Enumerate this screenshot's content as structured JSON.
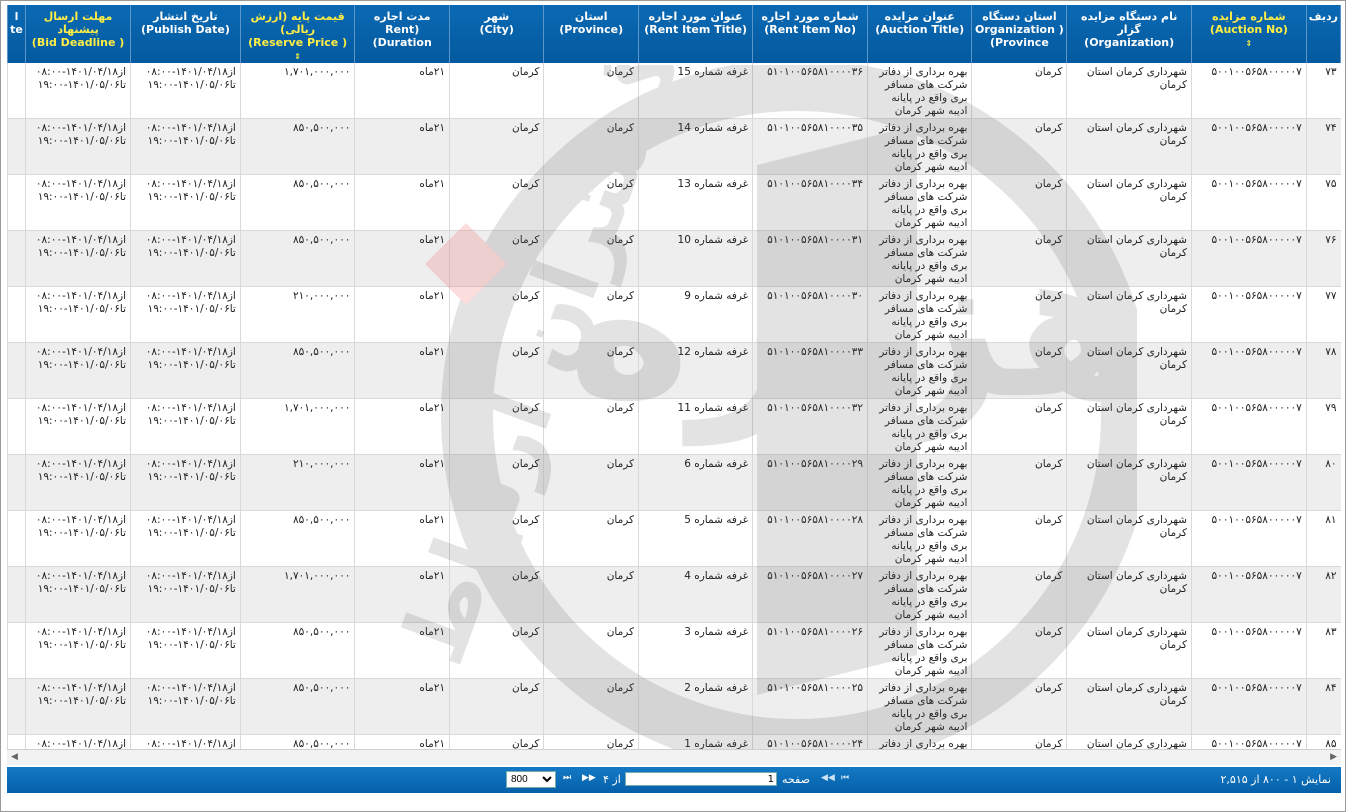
{
  "columns": [
    {
      "fa": "ردیف",
      "en": "",
      "highlight": false
    },
    {
      "fa": "شماره مزایده",
      "en": "(Auction No)",
      "highlight": true,
      "sort": true
    },
    {
      "fa": "نام دستگاه مزایده گزار",
      "en": "(Organization)",
      "highlight": false
    },
    {
      "fa": "استان دستگاه",
      "en": "Organization ) (Province",
      "highlight": false
    },
    {
      "fa": "عنوان مزایده",
      "en": "(Auction Title)",
      "highlight": false
    },
    {
      "fa": "شماره مورد اجاره",
      "en": "(Rent Item No)",
      "highlight": false
    },
    {
      "fa": "عنوان مورد اجاره",
      "en": "(Rent Item Title)",
      "highlight": false
    },
    {
      "fa": "استان",
      "en": "(Province)",
      "highlight": false
    },
    {
      "fa": "شهر",
      "en": "(City)",
      "highlight": false
    },
    {
      "fa": "مدت اجاره",
      "en": "(Rent Duration)",
      "highlight": false
    },
    {
      "fa": "قیمت پایه (ارزش ریالی)",
      "en": "( Reserve Price)",
      "highlight": true,
      "sort": true
    },
    {
      "fa": "تاریخ انتشار",
      "en": "(Publish Date)",
      "highlight": false
    },
    {
      "fa": "مهلت ارسال پیشنهاد",
      "en": "( Bid Deadline)",
      "highlight": true
    },
    {
      "fa": "l",
      "en": "te",
      "highlight": false
    }
  ],
  "rows": [
    {
      "row": "۷۳",
      "auction_no": "۵۰۰۱۰۰۵۶۵۸۰۰۰۰۰۷",
      "organization": "شهرداری کرمان استان کرمان",
      "org_province": "کرمان",
      "title": "بهره برداری از دفاتر شرکت های مسافر بری واقع در پایانه ادیبه شهر کرمان",
      "item_no": "۵۱۰۱۰۰۵۶۵۸۱۰۰۰۰۳۶",
      "item_title": "غرفه شماره 15",
      "province": "کرمان",
      "city": "کرمان",
      "duration": "۲۱ماه",
      "price": "۱,۷۰۱,۰۰۰,۰۰۰",
      "publish": "از۱۴۰۱/۰۴/۱۸-۰۸:۰۰ تا۱۴۰۱/۰۵/۰۶-۱۹:۰۰",
      "deadline": "از۱۴۰۱/۰۴/۱۸-۰۸:۰۰ تا۱۴۰۱/۰۵/۰۶-۱۹:۰۰"
    },
    {
      "row": "۷۴",
      "auction_no": "۵۰۰۱۰۰۵۶۵۸۰۰۰۰۰۷",
      "organization": "شهرداری کرمان استان کرمان",
      "org_province": "کرمان",
      "title": "بهره برداری از دفاتر شرکت های مسافر بری واقع در پایانه ادیبه شهر کرمان",
      "item_no": "۵۱۰۱۰۰۵۶۵۸۱۰۰۰۰۳۵",
      "item_title": "غرفه شماره 14",
      "province": "کرمان",
      "city": "کرمان",
      "duration": "۲۱ماه",
      "price": "۸۵۰,۵۰۰,۰۰۰",
      "publish": "از۱۴۰۱/۰۴/۱۸-۰۸:۰۰ تا۱۴۰۱/۰۵/۰۶-۱۹:۰۰",
      "deadline": "از۱۴۰۱/۰۴/۱۸-۰۸:۰۰ تا۱۴۰۱/۰۵/۰۶-۱۹:۰۰"
    },
    {
      "row": "۷۵",
      "auction_no": "۵۰۰۱۰۰۵۶۵۸۰۰۰۰۰۷",
      "organization": "شهرداری کرمان استان کرمان",
      "org_province": "کرمان",
      "title": "بهره برداری از دفاتر شرکت های مسافر بری واقع در پایانه ادیبه شهر کرمان",
      "item_no": "۵۱۰۱۰۰۵۶۵۸۱۰۰۰۰۳۴",
      "item_title": "غرفه شماره 13",
      "province": "کرمان",
      "city": "کرمان",
      "duration": "۲۱ماه",
      "price": "۸۵۰,۵۰۰,۰۰۰",
      "publish": "از۱۴۰۱/۰۴/۱۸-۰۸:۰۰ تا۱۴۰۱/۰۵/۰۶-۱۹:۰۰",
      "deadline": "از۱۴۰۱/۰۴/۱۸-۰۸:۰۰ تا۱۴۰۱/۰۵/۰۶-۱۹:۰۰"
    },
    {
      "row": "۷۶",
      "auction_no": "۵۰۰۱۰۰۵۶۵۸۰۰۰۰۰۷",
      "organization": "شهرداری کرمان استان کرمان",
      "org_province": "کرمان",
      "title": "بهره برداری از دفاتر شرکت های مسافر بری واقع در پایانه ادیبه شهر کرمان",
      "item_no": "۵۱۰۱۰۰۵۶۵۸۱۰۰۰۰۳۱",
      "item_title": "غرفه شماره 10",
      "province": "کرمان",
      "city": "کرمان",
      "duration": "۲۱ماه",
      "price": "۸۵۰,۵۰۰,۰۰۰",
      "publish": "از۱۴۰۱/۰۴/۱۸-۰۸:۰۰ تا۱۴۰۱/۰۵/۰۶-۱۹:۰۰",
      "deadline": "از۱۴۰۱/۰۴/۱۸-۰۸:۰۰ تا۱۴۰۱/۰۵/۰۶-۱۹:۰۰"
    },
    {
      "row": "۷۷",
      "auction_no": "۵۰۰۱۰۰۵۶۵۸۰۰۰۰۰۷",
      "organization": "شهرداری کرمان استان کرمان",
      "org_province": "کرمان",
      "title": "بهره برداری از دفاتر شرکت های مسافر بری واقع در پایانه ادیبه شهر کرمان",
      "item_no": "۵۱۰۱۰۰۵۶۵۸۱۰۰۰۰۳۰",
      "item_title": "غرفه شماره 9",
      "province": "کرمان",
      "city": "کرمان",
      "duration": "۲۱ماه",
      "price": "۲۱۰,۰۰۰,۰۰۰",
      "publish": "از۱۴۰۱/۰۴/۱۸-۰۸:۰۰ تا۱۴۰۱/۰۵/۰۶-۱۹:۰۰",
      "deadline": "از۱۴۰۱/۰۴/۱۸-۰۸:۰۰ تا۱۴۰۱/۰۵/۰۶-۱۹:۰۰"
    },
    {
      "row": "۷۸",
      "auction_no": "۵۰۰۱۰۰۵۶۵۸۰۰۰۰۰۷",
      "organization": "شهرداری کرمان استان کرمان",
      "org_province": "کرمان",
      "title": "بهره برداری از دفاتر شرکت های مسافر بری واقع در پایانه ادیبه شهر کرمان",
      "item_no": "۵۱۰۱۰۰۵۶۵۸۱۰۰۰۰۳۳",
      "item_title": "غرفه شماره 12",
      "province": "کرمان",
      "city": "کرمان",
      "duration": "۲۱ماه",
      "price": "۸۵۰,۵۰۰,۰۰۰",
      "publish": "از۱۴۰۱/۰۴/۱۸-۰۸:۰۰ تا۱۴۰۱/۰۵/۰۶-۱۹:۰۰",
      "deadline": "از۱۴۰۱/۰۴/۱۸-۰۸:۰۰ تا۱۴۰۱/۰۵/۰۶-۱۹:۰۰"
    },
    {
      "row": "۷۹",
      "auction_no": "۵۰۰۱۰۰۵۶۵۸۰۰۰۰۰۷",
      "organization": "شهرداری کرمان استان کرمان",
      "org_province": "کرمان",
      "title": "بهره برداری از دفاتر شرکت های مسافر بری واقع در پایانه ادیبه شهر کرمان",
      "item_no": "۵۱۰۱۰۰۵۶۵۸۱۰۰۰۰۳۲",
      "item_title": "غرفه شماره 11",
      "province": "کرمان",
      "city": "کرمان",
      "duration": "۲۱ماه",
      "price": "۱,۷۰۱,۰۰۰,۰۰۰",
      "publish": "از۱۴۰۱/۰۴/۱۸-۰۸:۰۰ تا۱۴۰۱/۰۵/۰۶-۱۹:۰۰",
      "deadline": "از۱۴۰۱/۰۴/۱۸-۰۸:۰۰ تا۱۴۰۱/۰۵/۰۶-۱۹:۰۰"
    },
    {
      "row": "۸۰",
      "auction_no": "۵۰۰۱۰۰۵۶۵۸۰۰۰۰۰۷",
      "organization": "شهرداری کرمان استان کرمان",
      "org_province": "کرمان",
      "title": "بهره برداری از دفاتر شرکت های مسافر بری واقع در پایانه ادیبه شهر کرمان",
      "item_no": "۵۱۰۱۰۰۵۶۵۸۱۰۰۰۰۲۹",
      "item_title": "غرفه شماره 6",
      "province": "کرمان",
      "city": "کرمان",
      "duration": "۲۱ماه",
      "price": "۲۱۰,۰۰۰,۰۰۰",
      "publish": "از۱۴۰۱/۰۴/۱۸-۰۸:۰۰ تا۱۴۰۱/۰۵/۰۶-۱۹:۰۰",
      "deadline": "از۱۴۰۱/۰۴/۱۸-۰۸:۰۰ تا۱۴۰۱/۰۵/۰۶-۱۹:۰۰"
    },
    {
      "row": "۸۱",
      "auction_no": "۵۰۰۱۰۰۵۶۵۸۰۰۰۰۰۷",
      "organization": "شهرداری کرمان استان کرمان",
      "org_province": "کرمان",
      "title": "بهره برداری از دفاتر شرکت های مسافر بری واقع در پایانه ادیبه شهر کرمان",
      "item_no": "۵۱۰۱۰۰۵۶۵۸۱۰۰۰۰۲۸",
      "item_title": "غرفه شماره 5",
      "province": "کرمان",
      "city": "کرمان",
      "duration": "۲۱ماه",
      "price": "۸۵۰,۵۰۰,۰۰۰",
      "publish": "از۱۴۰۱/۰۴/۱۸-۰۸:۰۰ تا۱۴۰۱/۰۵/۰۶-۱۹:۰۰",
      "deadline": "از۱۴۰۱/۰۴/۱۸-۰۸:۰۰ تا۱۴۰۱/۰۵/۰۶-۱۹:۰۰"
    },
    {
      "row": "۸۲",
      "auction_no": "۵۰۰۱۰۰۵۶۵۸۰۰۰۰۰۷",
      "organization": "شهرداری کرمان استان کرمان",
      "org_province": "کرمان",
      "title": "بهره برداری از دفاتر شرکت های مسافر بری واقع در پایانه ادیبه شهر کرمان",
      "item_no": "۵۱۰۱۰۰۵۶۵۸۱۰۰۰۰۲۷",
      "item_title": "غرفه شماره 4",
      "province": "کرمان",
      "city": "کرمان",
      "duration": "۲۱ماه",
      "price": "۱,۷۰۱,۰۰۰,۰۰۰",
      "publish": "از۱۴۰۱/۰۴/۱۸-۰۸:۰۰ تا۱۴۰۱/۰۵/۰۶-۱۹:۰۰",
      "deadline": "از۱۴۰۱/۰۴/۱۸-۰۸:۰۰ تا۱۴۰۱/۰۵/۰۶-۱۹:۰۰"
    },
    {
      "row": "۸۳",
      "auction_no": "۵۰۰۱۰۰۵۶۵۸۰۰۰۰۰۷",
      "organization": "شهرداری کرمان استان کرمان",
      "org_province": "کرمان",
      "title": "بهره برداری از دفاتر شرکت های مسافر بری واقع در پایانه ادیبه شهر کرمان",
      "item_no": "۵۱۰۱۰۰۵۶۵۸۱۰۰۰۰۲۶",
      "item_title": "غرفه شماره 3",
      "province": "کرمان",
      "city": "کرمان",
      "duration": "۲۱ماه",
      "price": "۸۵۰,۵۰۰,۰۰۰",
      "publish": "از۱۴۰۱/۰۴/۱۸-۰۸:۰۰ تا۱۴۰۱/۰۵/۰۶-۱۹:۰۰",
      "deadline": "از۱۴۰۱/۰۴/۱۸-۰۸:۰۰ تا۱۴۰۱/۰۵/۰۶-۱۹:۰۰"
    },
    {
      "row": "۸۴",
      "auction_no": "۵۰۰۱۰۰۵۶۵۸۰۰۰۰۰۷",
      "organization": "شهرداری کرمان استان کرمان",
      "org_province": "کرمان",
      "title": "بهره برداری از دفاتر شرکت های مسافر بری واقع در پایانه ادیبه شهر کرمان",
      "item_no": "۵۱۰۱۰۰۵۶۵۸۱۰۰۰۰۲۵",
      "item_title": "غرفه شماره 2",
      "province": "کرمان",
      "city": "کرمان",
      "duration": "۲۱ماه",
      "price": "۸۵۰,۵۰۰,۰۰۰",
      "publish": "از۱۴۰۱/۰۴/۱۸-۰۸:۰۰ تا۱۴۰۱/۰۵/۰۶-۱۹:۰۰",
      "deadline": "از۱۴۰۱/۰۴/۱۸-۰۸:۰۰ تا۱۴۰۱/۰۵/۰۶-۱۹:۰۰"
    },
    {
      "row": "۸۵",
      "auction_no": "۵۰۰۱۰۰۵۶۵۸۰۰۰۰۰۷",
      "organization": "شهرداری کرمان استان کرمان",
      "org_province": "کرمان",
      "title": "بهره برداری از دفاتر شرکت های مسافر بری واقع در پایانه ادیبه شهر کرمان",
      "item_no": "۵۱۰۱۰۰۵۶۵۸۱۰۰۰۰۲۴",
      "item_title": "غرفه شماره 1",
      "province": "کرمان",
      "city": "کرمان",
      "duration": "۲۱ماه",
      "price": "۸۵۰,۵۰۰,۰۰۰",
      "publish": "از۱۴۰۱/۰۴/۱۸-۰۸:۰۰ تا۱۴۰۱/۰۵/۰۶-۱۹:۰۰",
      "deadline": "از۱۴۰۱/۰۴/۱۸-۰۸:۰۰ تا۱۴۰۱/۰۵/۰۶-۱۹:۰۰"
    }
  ],
  "pager": {
    "info": "نمایش ۱ - ۸۰۰ از ۲,۵۱۵",
    "page_label": "صفحه",
    "page_value": "1",
    "of_label": "از ۴",
    "page_size": "800",
    "first_icon": "first-page-icon",
    "prev_icon": "prev-page-icon",
    "next_icon": "next-page-icon",
    "last_icon": "last-page-icon"
  },
  "watermark": {
    "brand_text": "گستران ارتباط",
    "brand_mark": "هزاره"
  },
  "colors": {
    "header_bg": "#0a69b4",
    "header_highlight": "#ffee44",
    "auction_no": "#1c9d1c",
    "item_no": "#1b2fb0",
    "pager_bg": "#1479c6",
    "alt_row": "#eeeeee"
  }
}
